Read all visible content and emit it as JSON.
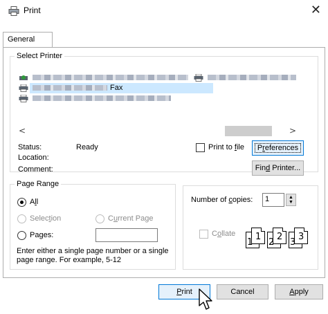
{
  "window": {
    "title": "Print",
    "close_glyph": "✕"
  },
  "tabs": [
    {
      "label": "General"
    }
  ],
  "select_printer": {
    "legend": "Select Printer",
    "printers": [
      {
        "label": "",
        "icon": "printer-status-icon"
      },
      {
        "label": "",
        "icon": "printer-icon"
      },
      {
        "label": "Fax",
        "icon": "fax-printer-icon",
        "selected": true
      },
      {
        "label": "",
        "icon": "printer-icon"
      }
    ],
    "status_label": "Status:",
    "status_value": "Ready",
    "location_label": "Location:",
    "comment_label": "Comment:",
    "print_to_file": {
      "pre": "Print to ",
      "key": "f",
      "post": "ile",
      "checked": false
    },
    "preferences": {
      "pre": "P",
      "key": "r",
      "post": "eferences"
    },
    "find_printer": {
      "pre": "Fin",
      "key": "d",
      "post": " Printer..."
    }
  },
  "page_range": {
    "legend": "Page Range",
    "all": {
      "pre": "A",
      "key": "l",
      "post": "l",
      "checked": true
    },
    "selection": {
      "pre": "Selec",
      "key": "t",
      "post": "ion",
      "enabled": false
    },
    "current_page": {
      "pre": "C",
      "key": "u",
      "post": "rrent Page",
      "enabled": false
    },
    "pages": {
      "pre": "Pa",
      "key": "g",
      "post": "es:",
      "value": ""
    },
    "hint_line1": "Enter either a single page number or a single",
    "hint_line2": "page range.  For example, 5-12"
  },
  "copies": {
    "label_pre": "Number of ",
    "label_key": "c",
    "label_post": "opies:",
    "value": "1",
    "collate": {
      "pre": "C",
      "key": "o",
      "post": "llate",
      "enabled": false,
      "checked": false
    },
    "collate_pages": [
      "1",
      "1",
      "2",
      "2",
      "3",
      "3"
    ]
  },
  "buttons": {
    "print": {
      "pre": "",
      "key": "P",
      "post": "rint"
    },
    "cancel": {
      "label": "Cancel"
    },
    "apply": {
      "pre": "",
      "key": "A",
      "post": "pply"
    }
  },
  "colors": {
    "accent": "#0078d7",
    "selection": "#cce8ff",
    "button_face": "#e1e1e1"
  }
}
